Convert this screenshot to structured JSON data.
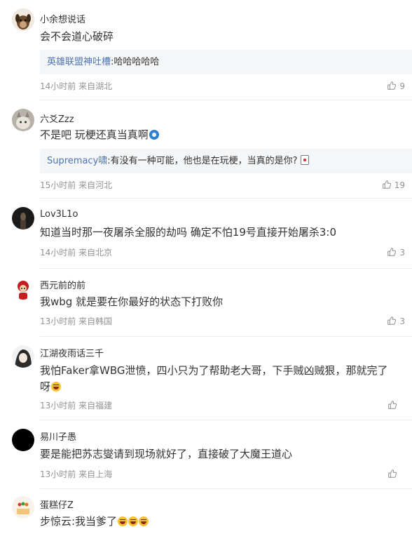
{
  "comments": [
    {
      "user": "小余想说话",
      "text": "会不会道心破碎",
      "reply": {
        "user": "英雄联盟神吐槽",
        "text": ":哈哈哈哈哈"
      },
      "meta": "14小时前 来自湖北",
      "likes": "9",
      "avatar_icon": "dog-avatar-icon"
    },
    {
      "user": "六爻Zzz",
      "text": "不是吧 玩梗还真当真啊",
      "reply": {
        "user": "Supremacy啸",
        "text": ":有没有一种可能，他也是在玩梗，当真的是你?"
      },
      "meta": "15小时前 来自河北",
      "likes": "19",
      "avatar_icon": "cat-avatar-icon"
    },
    {
      "user": "Lov3L1o",
      "text": "知道当时那一夜屠杀全服的劫吗 确定不怕19号直接开始屠杀3:0",
      "meta": "14小时前 来自北京",
      "likes": "3",
      "avatar_icon": "dark-figure-avatar-icon"
    },
    {
      "user": "西元前的前",
      "text": "我wbg 就是要在你最好的状态下打败你",
      "meta": "13小时前 来自韩国",
      "likes": "3",
      "avatar_icon": "red-character-avatar-icon"
    },
    {
      "user": "江湖夜雨话三千",
      "text_lines": [
        "我怕Faker拿WBG泄愤，四小只为了帮助老大哥，下手贼凶贼狠，那就完了",
        "呀"
      ],
      "meta": "13小时前 来自福建",
      "likes": "",
      "avatar_icon": "anime-avatar-icon"
    },
    {
      "user": "易川子愚",
      "text": "要是能把苏志燮请到现场就好了，直接破了大魔王道心",
      "meta": "13小时前 来自上海",
      "likes": "",
      "avatar_icon": "black-circle-avatar-icon"
    },
    {
      "user": "蛋糕仔Z",
      "text": "步惊云:我当爹了",
      "avatar_icon": "cake-avatar-icon"
    }
  ],
  "colors": {
    "reply_user": "#4d75b5",
    "meta": "#939393",
    "reply_bg": "#f5f6f7",
    "text": "#333333"
  }
}
